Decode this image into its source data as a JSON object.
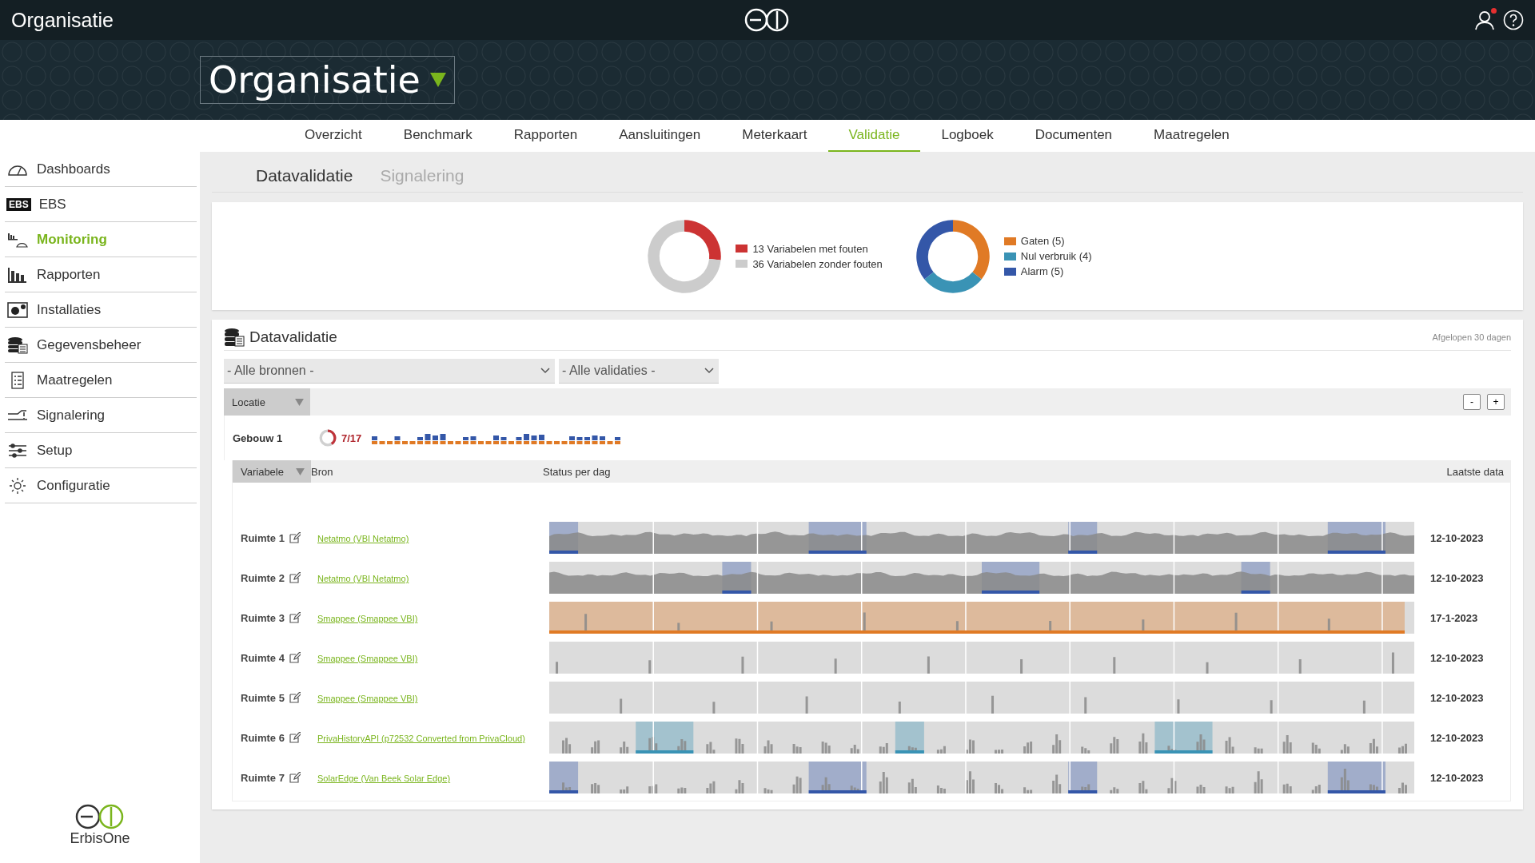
{
  "topbar": {
    "title": "Organisatie",
    "notification": true
  },
  "banner": {
    "title": "Organisatie"
  },
  "tabs": [
    {
      "label": "Overzicht",
      "selected": false
    },
    {
      "label": "Benchmark",
      "selected": false
    },
    {
      "label": "Rapporten",
      "selected": false
    },
    {
      "label": "Aansluitingen",
      "selected": false
    },
    {
      "label": "Meterkaart",
      "selected": false
    },
    {
      "label": "Validatie",
      "selected": true
    },
    {
      "label": "Logboek",
      "selected": false
    },
    {
      "label": "Documenten",
      "selected": false
    },
    {
      "label": "Maatregelen",
      "selected": false
    }
  ],
  "sidebar": {
    "items": [
      {
        "label": "Dashboards",
        "selected": false
      },
      {
        "label": "EBS",
        "selected": false,
        "badge": "EBS"
      },
      {
        "label": "Monitoring",
        "selected": true
      },
      {
        "label": "Rapporten",
        "selected": false
      },
      {
        "label": "Installaties",
        "selected": false
      },
      {
        "label": "Gegevensbeheer",
        "selected": false
      },
      {
        "label": "Maatregelen",
        "selected": false
      },
      {
        "label": "Signalering",
        "selected": false
      },
      {
        "label": "Setup",
        "selected": false
      },
      {
        "label": "Configuratie",
        "selected": false
      }
    ],
    "logo_text": "ErbisOne"
  },
  "subtabs": [
    {
      "label": "Datavalidatie",
      "selected": true
    },
    {
      "label": "Signalering",
      "selected": false
    }
  ],
  "summary": {
    "charts": [
      {
        "slices": [
          {
            "color": "#cc3333"
          },
          {
            "color": "#cccccc"
          }
        ],
        "chart_data": {
          "type": "donut",
          "categories": [
            "13 Variabelen met fouten",
            "36 Variabelen zonder fouten"
          ],
          "values": [
            13,
            36
          ],
          "legend": "right"
        }
      },
      {
        "slices": [
          {
            "color": "#e07a25"
          },
          {
            "color": "#3a93b5"
          },
          {
            "color": "#3457a8"
          }
        ],
        "chart_data": {
          "type": "donut",
          "categories": [
            "Gaten (5)",
            "Nul verbruik (4)",
            "Alarm (5)"
          ],
          "values": [
            5,
            4,
            5
          ],
          "legend": "right"
        }
      }
    ]
  },
  "validation": {
    "title": "Datavalidatie",
    "period": "Afgelopen 30 dagen",
    "filters": [
      {
        "value": "- Alle bronnen -"
      },
      {
        "value": "- Alle validaties -"
      }
    ],
    "group_column": "Locatie",
    "zoom_buttons": [
      "-",
      "+"
    ],
    "group": {
      "name": "Gebouw 1",
      "count": "7/17",
      "level": 0.41
    },
    "columns": [
      "Variabele",
      "Bron",
      "Status per dag",
      "Laatste data"
    ],
    "rows": [
      {
        "name": "Ruimte 1",
        "source": "Netatmo (VBI Netatmo)",
        "last": "12-10-2023",
        "kind": "continuous",
        "color": "#3457a8",
        "full": false
      },
      {
        "name": "Ruimte 2",
        "source": "Netatmo (VBI Netatmo)",
        "last": "12-10-2023",
        "kind": "continuous",
        "color": "#3457a8",
        "full": false
      },
      {
        "name": "Ruimte 3",
        "source": "Smappee (Smappee VBI)",
        "last": "17-1-2023",
        "kind": "spikes",
        "color": "#e07a25",
        "full": true
      },
      {
        "name": "Ruimte 4",
        "source": "Smappee (Smappee VBI)",
        "last": "12-10-2023",
        "kind": "spikes"
      },
      {
        "name": "Ruimte 5",
        "source": "Smappee (Smappee VBI)",
        "last": "12-10-2023",
        "kind": "spikes"
      },
      {
        "name": "Ruimte 6",
        "source": "PrivaHistoryAPI (p72532 Converted from PrivaCloud)",
        "last": "12-10-2023",
        "kind": "dense",
        "color": "#3a93b5",
        "full": false
      },
      {
        "name": "Ruimte 7",
        "source": "SolarEdge (Van Beek Solar Edge)",
        "last": "12-10-2023",
        "kind": "dense",
        "color": "#3457a8",
        "full": false
      }
    ]
  }
}
